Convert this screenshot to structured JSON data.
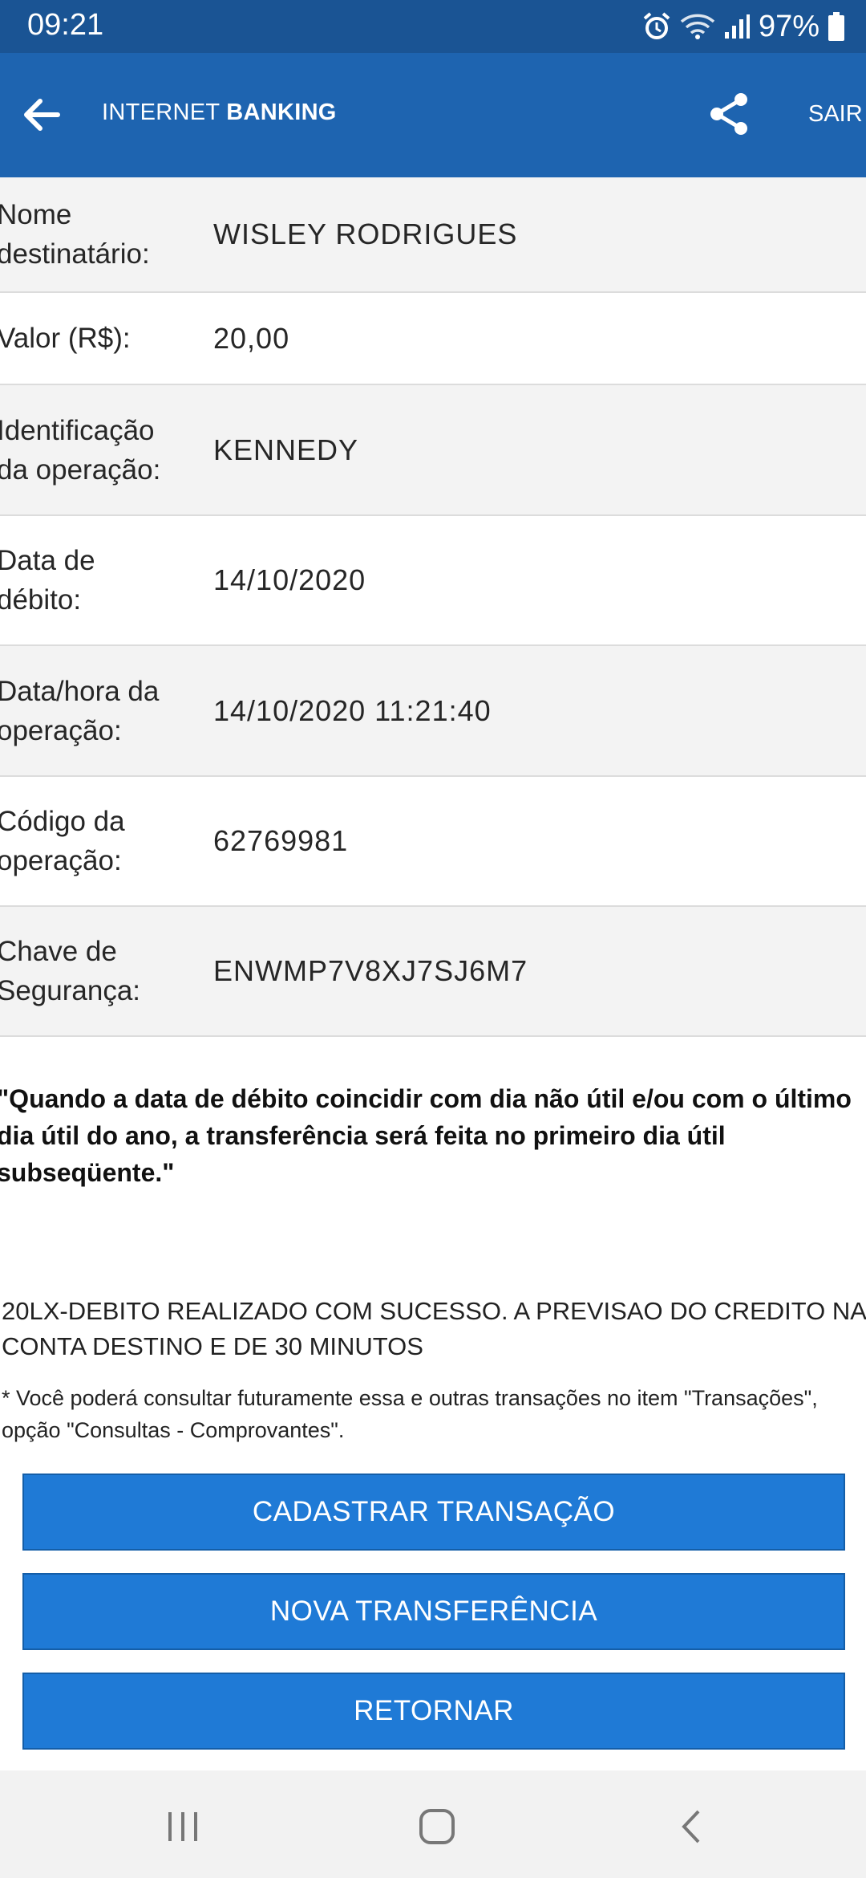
{
  "status_bar": {
    "time": "09:21",
    "battery": "97%",
    "icons": [
      "alarm-icon",
      "wifi-icon",
      "signal-icon",
      "battery-icon"
    ]
  },
  "app_bar": {
    "title_regular": "INTERNET ",
    "title_bold": "BANKING",
    "sair": "SAIR",
    "icons": [
      "back-arrow-icon",
      "share-icon"
    ]
  },
  "details": [
    {
      "label": "Nome\ndestinatário:",
      "value": "WISLEY RODRIGUES"
    },
    {
      "label": "Valor (R$):",
      "value": "20,00"
    },
    {
      "label": "Identificação\nda operação:",
      "value": "KENNEDY"
    },
    {
      "label": "Data de\ndébito:",
      "value": "14/10/2020"
    },
    {
      "label": "Data/hora da\noperação:",
      "value": "14/10/2020 11:21:40"
    },
    {
      "label": "Código da\noperação:",
      "value": "62769981"
    },
    {
      "label": "Chave de\nSegurança:",
      "value": "ENWMP7V8XJ7SJ6M7"
    }
  ],
  "notices": {
    "bold": "\"Quando a data de débito coincidir com dia não útil e/ou com o último dia útil do ano, a transferência será feita no primeiro dia útil subseqüente.\"",
    "success": "20LX-DEBITO REALIZADO COM SUCESSO. A PREVISAO DO CREDITO NA CONTA DESTINO E DE 30 MINUTOS",
    "note": "* Você poderá consultar futuramente essa e outras transações no item \"Transações\", opção \"Consultas - Comprovantes\"."
  },
  "buttons": {
    "cadastrar": "CADASTRAR TRANSAÇÃO",
    "nova": "NOVA TRANSFERÊNCIA",
    "retornar": "RETORNAR"
  },
  "colors": {
    "status_bar": "#1a5494",
    "app_bar": "#1e64b0",
    "button": "#1f7ad6",
    "row_alt": "#f3f3f3"
  }
}
